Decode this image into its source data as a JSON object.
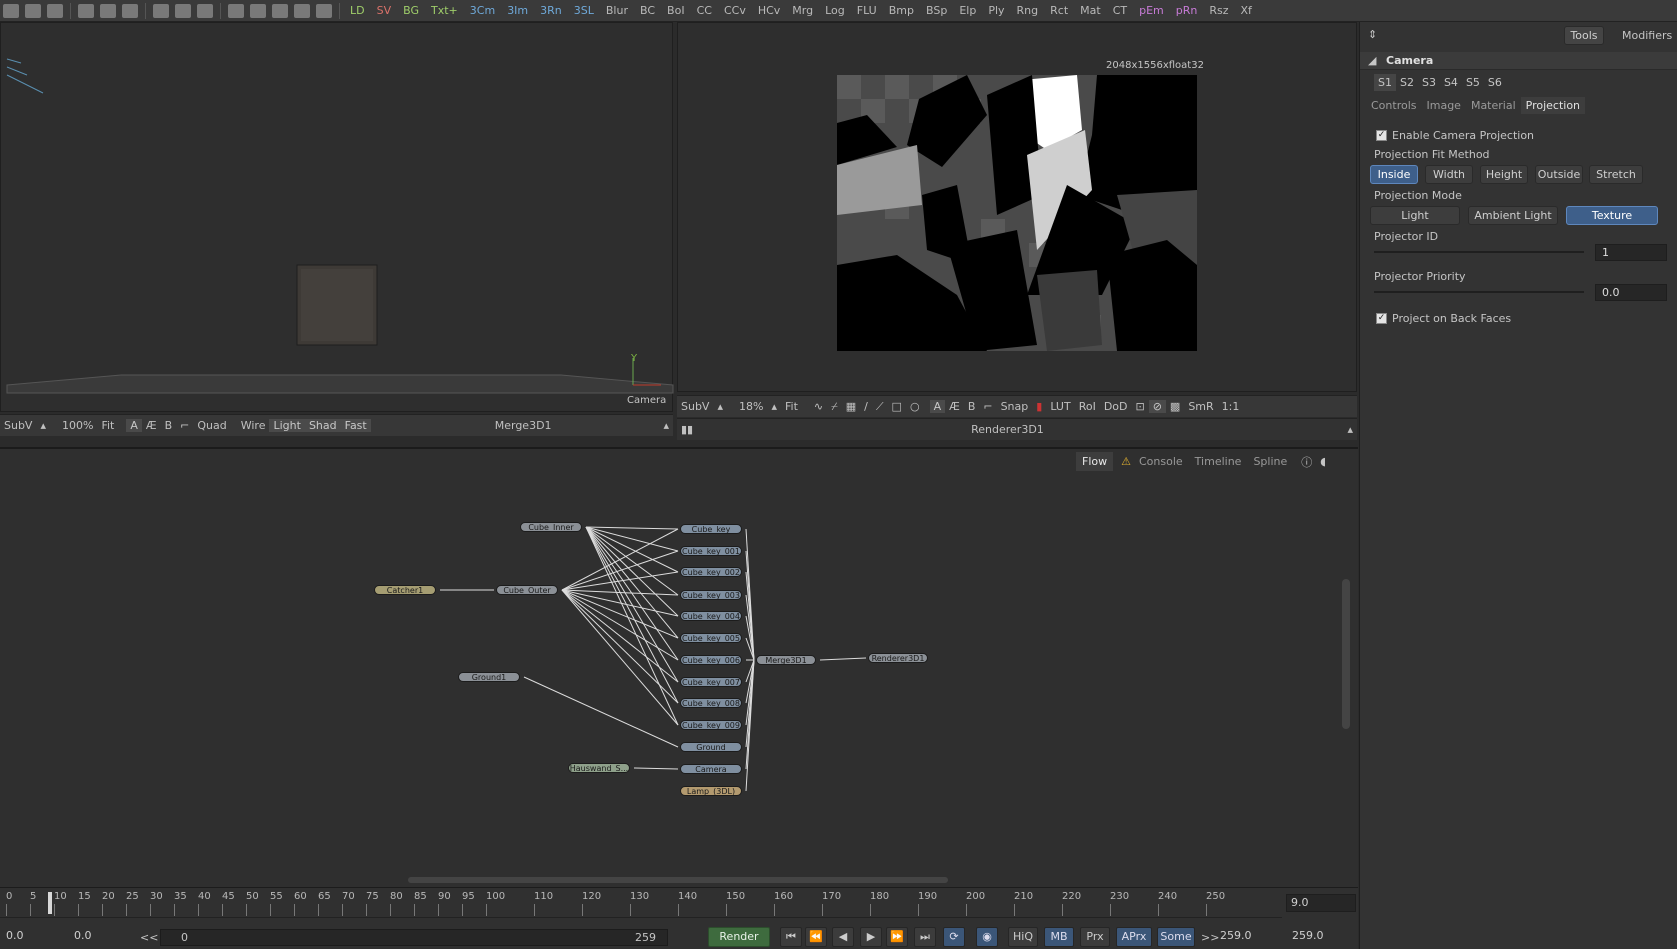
{
  "toolbar": {
    "tools": [
      "LD",
      "SV",
      "BG",
      "Txt+",
      "3Cm",
      "3Im",
      "3Rn",
      "3SL",
      "Blur",
      "BC",
      "BoI",
      "CC",
      "CCv",
      "HCv",
      "Mrg",
      "Log",
      "FLU",
      "Bmp",
      "BSp",
      "Elp",
      "Ply",
      "Rng",
      "Rct",
      "Mat",
      "CT",
      "pEm",
      "pRn",
      "Rsz",
      "Xf"
    ]
  },
  "viewer_left": {
    "axis_label": "Y",
    "camera_label": "Camera",
    "bar": {
      "subv": "SubV",
      "zoom": "100%",
      "fit": "Fit",
      "a": "A",
      "b": "B",
      "quad": "Quad",
      "wire": "Wire",
      "light": "Light",
      "shad": "Shad",
      "fast": "Fast",
      "title": "Merge3D1"
    }
  },
  "viewer_right": {
    "resolution": "2048x1556xfloat32",
    "bar": {
      "subv": "SubV",
      "zoom": "18%",
      "fit": "Fit",
      "a": "A",
      "b": "B",
      "snap": "Snap",
      "lut": "LUT",
      "roi": "RoI",
      "dod": "DoD",
      "smr": "SmR",
      "ratio": "1:1",
      "title": "Renderer3D1"
    }
  },
  "inspector": {
    "tabs": {
      "tools": "Tools",
      "modifiers": "Modifiers"
    },
    "section_title": "Camera",
    "slots": [
      "S1",
      "S2",
      "S3",
      "S4",
      "S5",
      "S6"
    ],
    "subtabs": [
      "Controls",
      "Image",
      "Material",
      "Projection"
    ],
    "enable_projection_label": "Enable Camera Projection",
    "fit_method_label": "Projection Fit Method",
    "fit_methods": [
      "Inside",
      "Width",
      "Height",
      "Outside",
      "Stretch"
    ],
    "fit_method_selected": "Inside",
    "mode_label": "Projection Mode",
    "modes": [
      "Light",
      "Ambient Light",
      "Texture"
    ],
    "mode_selected": "Texture",
    "projector_id_label": "Projector ID",
    "projector_id_value": "1",
    "projector_priority_label": "Projector Priority",
    "projector_priority_value": "0.0",
    "back_faces_label": "Project on Back Faces"
  },
  "flow": {
    "tabs": [
      "Flow",
      "Console",
      "Timeline",
      "Spline"
    ],
    "nodes": {
      "cube_inner": "Cube_Inner",
      "cube_outer": "Cube_Outer",
      "catcher": "Catcher1",
      "ground1": "Ground1",
      "hauswand": "Hauswand_S...",
      "keys": [
        "Cube_key",
        "Cube_key_001",
        "Cube_key_002",
        "Cube_key_003",
        "Cube_key_004",
        "Cube_key_005",
        "Cube_key_006",
        "Cube_key_007",
        "Cube_key_008",
        "Cube_key_009"
      ],
      "ground": "Ground",
      "camera": "Camera",
      "lamp": "Lamp_(3DL)",
      "merge": "Merge3D1",
      "renderer": "Renderer3D1"
    }
  },
  "timeline": {
    "ticks": [
      "0",
      "5",
      "10",
      "15",
      "20",
      "25",
      "30",
      "35",
      "40",
      "45",
      "50",
      "55",
      "60",
      "65",
      "70",
      "75",
      "80",
      "85",
      "90",
      "95",
      "100",
      "110",
      "120",
      "130",
      "140",
      "150",
      "160",
      "170",
      "180",
      "190",
      "200",
      "210",
      "220",
      "230",
      "240",
      "250"
    ],
    "current_value": "9.0",
    "start": "0.0",
    "start2": "0.0",
    "range_start": "0",
    "range_end": "259",
    "render_label": "Render",
    "hiq": "HiQ",
    "mb": "MB",
    "prx": "Prx",
    "aprx": "APrx",
    "some": "Some",
    "end1": "259.0",
    "end2": "259.0",
    "back_label": "<<",
    "fwd_label": ">>"
  }
}
